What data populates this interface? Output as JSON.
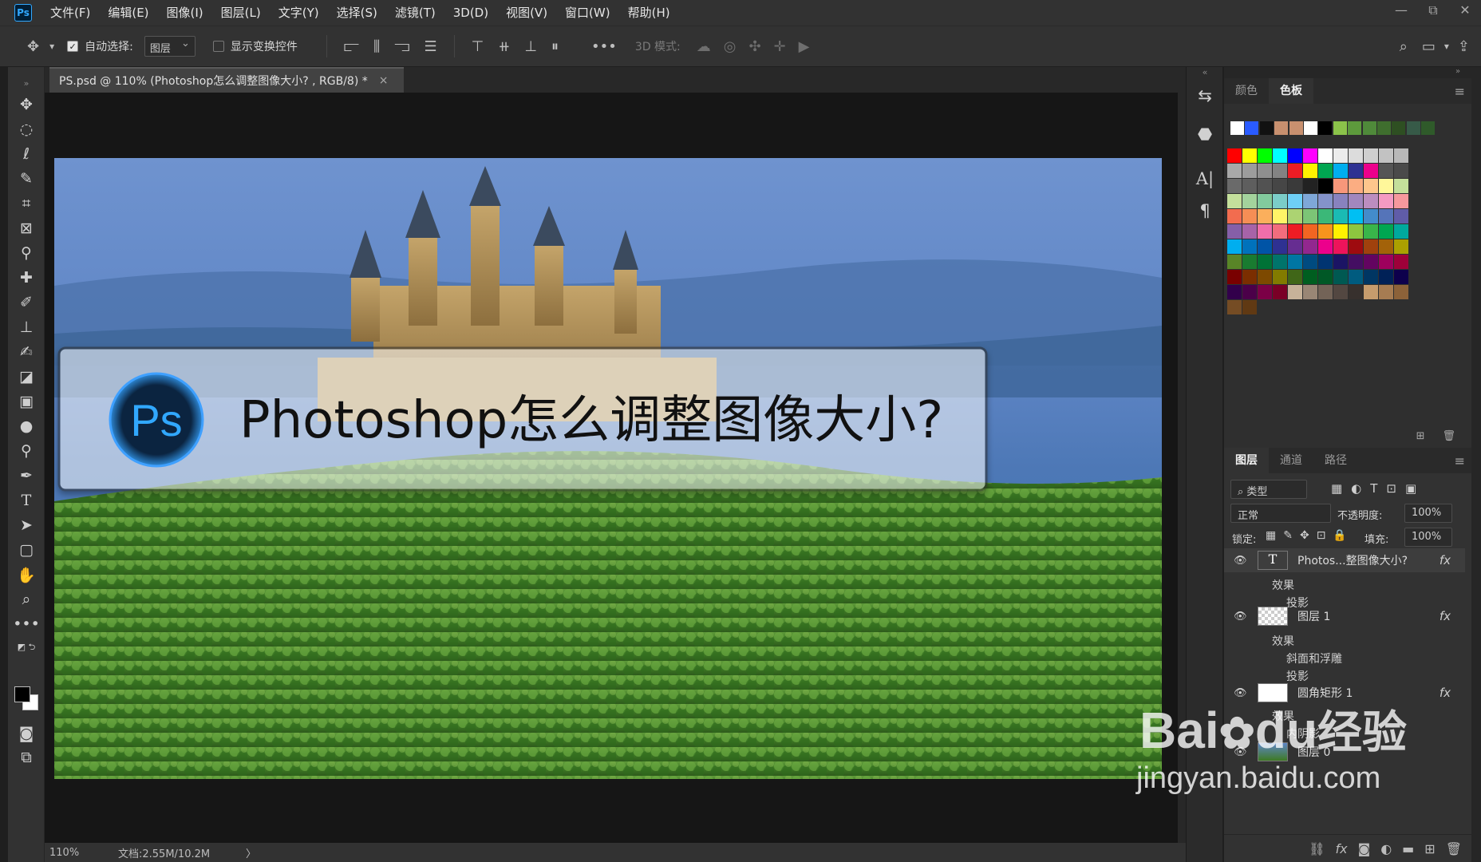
{
  "app": {
    "logo_text": "Ps",
    "menu": [
      "文件(F)",
      "编辑(E)",
      "图像(I)",
      "图层(L)",
      "文字(Y)",
      "选择(S)",
      "滤镜(T)",
      "3D(D)",
      "视图(V)",
      "窗口(W)",
      "帮助(H)"
    ],
    "window_controls": [
      "—",
      "⧉",
      "✕"
    ]
  },
  "options": {
    "auto_select_label": "自动选择:",
    "auto_select_checked": true,
    "target_select": "图层",
    "show_transform_label": "显示变换控件",
    "show_transform_checked": false,
    "mode_3d_label": "3D 模式:",
    "more_label": "•••"
  },
  "document": {
    "tab_title": "PS.psd @ 110% (Photoshop怎么调整图像大小? , RGB/8) *",
    "close_glyph": "×",
    "banner_logo": "Ps",
    "banner_text": "Photoshop怎么调整图像大小?"
  },
  "status": {
    "zoom": "110%",
    "doc_info": "文档:2.55M/10.2M",
    "arrow": "〉"
  },
  "tools": {
    "icons": [
      "move-icon",
      "marquee-icon",
      "lasso-icon",
      "quick-select-icon",
      "crop-icon",
      "frame-icon",
      "eyedropper-icon",
      "healing-icon",
      "brush-icon",
      "stamp-icon",
      "history-brush-icon",
      "eraser-icon",
      "gradient-icon",
      "blur-icon",
      "dodge-icon",
      "pen-icon",
      "type-icon",
      "path-select-icon",
      "shape-icon",
      "hand-icon",
      "zoom-icon",
      "more-tools-icon"
    ]
  },
  "swatches_panel": {
    "tabs": [
      "颜色",
      "色板"
    ],
    "active_tab": "色板",
    "recent": [
      "#ffffff",
      "#2a5bff",
      "#111111",
      "#c8906f",
      "#c8906f",
      "#ffffff",
      "#000000",
      "#8bc34a",
      "#5d9a3c",
      "#4f8a3a",
      "#3f6e2e",
      "#2e4f22",
      "#375a48",
      "#2f5a2a"
    ],
    "grid": [
      [
        "#ff0000",
        "#ffff00",
        "#00ff00",
        "#00ffff",
        "#0000ff",
        "#ff00ff",
        "#ffffff",
        "#ececec",
        "#dcdcdc",
        "#cfcfcf",
        "#c2c2c2",
        "#b8b8b8"
      ],
      [
        "#a8a8a8",
        "#9c9c9c",
        "#8f8f8f",
        "#838383",
        "#ed1c24",
        "#fff200",
        "#00a651",
        "#00aeef",
        "#2e3192",
        "#ec008c",
        "#555555",
        "#4a4a4a"
      ],
      [
        "#6a6a6a",
        "#5e5e5e",
        "#525252",
        "#464646",
        "#3a3a3a",
        "#222222",
        "#000000",
        "#f7977a",
        "#fbad82",
        "#fdc68c",
        "#fff79a",
        "#c4df9b"
      ],
      [
        "#c4df9b",
        "#a3d39c",
        "#82ca9d",
        "#7bcdc8",
        "#6ecff6",
        "#7ea7d8",
        "#8493ca",
        "#8882be",
        "#a187be",
        "#bc8dbf",
        "#f49ac2",
        "#f6989d"
      ],
      [
        "#f26c4f",
        "#f68e55",
        "#fbaf5c",
        "#fff467",
        "#acd372",
        "#7cc576",
        "#3bb878",
        "#1abbb4",
        "#00bff3",
        "#438ccb",
        "#5574b9",
        "#605ca8"
      ],
      [
        "#855fa8",
        "#a763a8",
        "#f06eaa",
        "#f26d7d",
        "#ed1c24",
        "#f26522",
        "#f7941d",
        "#fff200",
        "#8dc63f",
        "#39b54a",
        "#00a651",
        "#00a99d"
      ],
      [
        "#00aeef",
        "#0072bc",
        "#0054a6",
        "#2e3192",
        "#662d91",
        "#92278f",
        "#ec008c",
        "#ed145b",
        "#9e0b0f",
        "#a0410d",
        "#a36209",
        "#aba000"
      ],
      [
        "#598527",
        "#197b30",
        "#007236",
        "#00746b",
        "#0076a3",
        "#004b80",
        "#003471",
        "#1b1464",
        "#440e62",
        "#630460",
        "#9e005d",
        "#9e0039"
      ],
      [
        "#790000",
        "#7b2e00",
        "#7d4900",
        "#827b00",
        "#406618",
        "#005e20",
        "#005826",
        "#005952",
        "#005b7f",
        "#003663",
        "#002157",
        "#0d004c"
      ],
      [
        "#32004b",
        "#4b0049",
        "#7b0046",
        "#7a0026",
        "#c7b299",
        "#998675",
        "#736357",
        "#534741",
        "#37302d",
        "#c69c6d",
        "#a67c52",
        "#8c6239"
      ],
      [
        "#754c24",
        "#603913"
      ]
    ]
  },
  "layers_panel": {
    "tabs": [
      "图层",
      "通道",
      "路径"
    ],
    "active_tab": "图层",
    "filter_label": "类型",
    "blend_mode": "正常",
    "opacity_label": "不透明度:",
    "opacity_value": "100%",
    "lock_label": "锁定:",
    "fill_label": "填充:",
    "fill_value": "100%",
    "fx_label": "fx",
    "layers": [
      {
        "name": "Photos...整图像大小?",
        "kind": "text",
        "effects": [
          "效果",
          "投影"
        ]
      },
      {
        "name": "图层 1",
        "kind": "pixel",
        "effects": [
          "效果",
          "斜面和浮雕",
          "投影"
        ]
      },
      {
        "name": "圆角矩形 1",
        "kind": "shape",
        "effects": [
          "效果",
          "内阴影"
        ]
      },
      {
        "name": "图层 0",
        "kind": "image",
        "effects": []
      }
    ]
  },
  "watermark": {
    "brand": "Bai",
    "brand2": "du",
    "cn": "经验",
    "url": "jingyan.baidu.com"
  }
}
